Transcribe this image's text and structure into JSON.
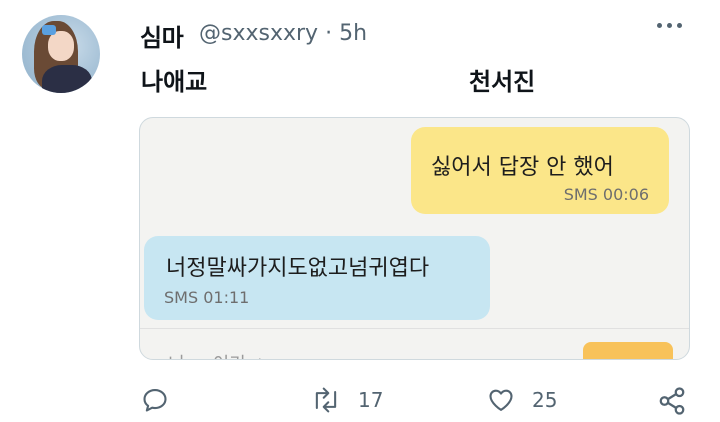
{
  "author": {
    "name": "심마",
    "handle": "@sxxsxxry",
    "separator": "·",
    "time": "5h"
  },
  "tweet": {
    "text_left": "나애교",
    "text_right": "천서진"
  },
  "media": {
    "messages": [
      {
        "text": "싫어서 답장 안 했어",
        "meta": "SMS 00:06",
        "color": "#fbe689"
      },
      {
        "text": "너정말싸가지도없고넘귀엽다",
        "meta": "SMS 01:11",
        "color": "#c7e6f2"
      }
    ],
    "cut_text": "너 ㅡ 이기 ㅅ ..."
  },
  "actions": {
    "reply_icon": "reply-icon",
    "retweet_icon": "retweet-icon",
    "retweet_count": "17",
    "like_icon": "heart-icon",
    "like_count": "25",
    "share_icon": "share-icon"
  }
}
